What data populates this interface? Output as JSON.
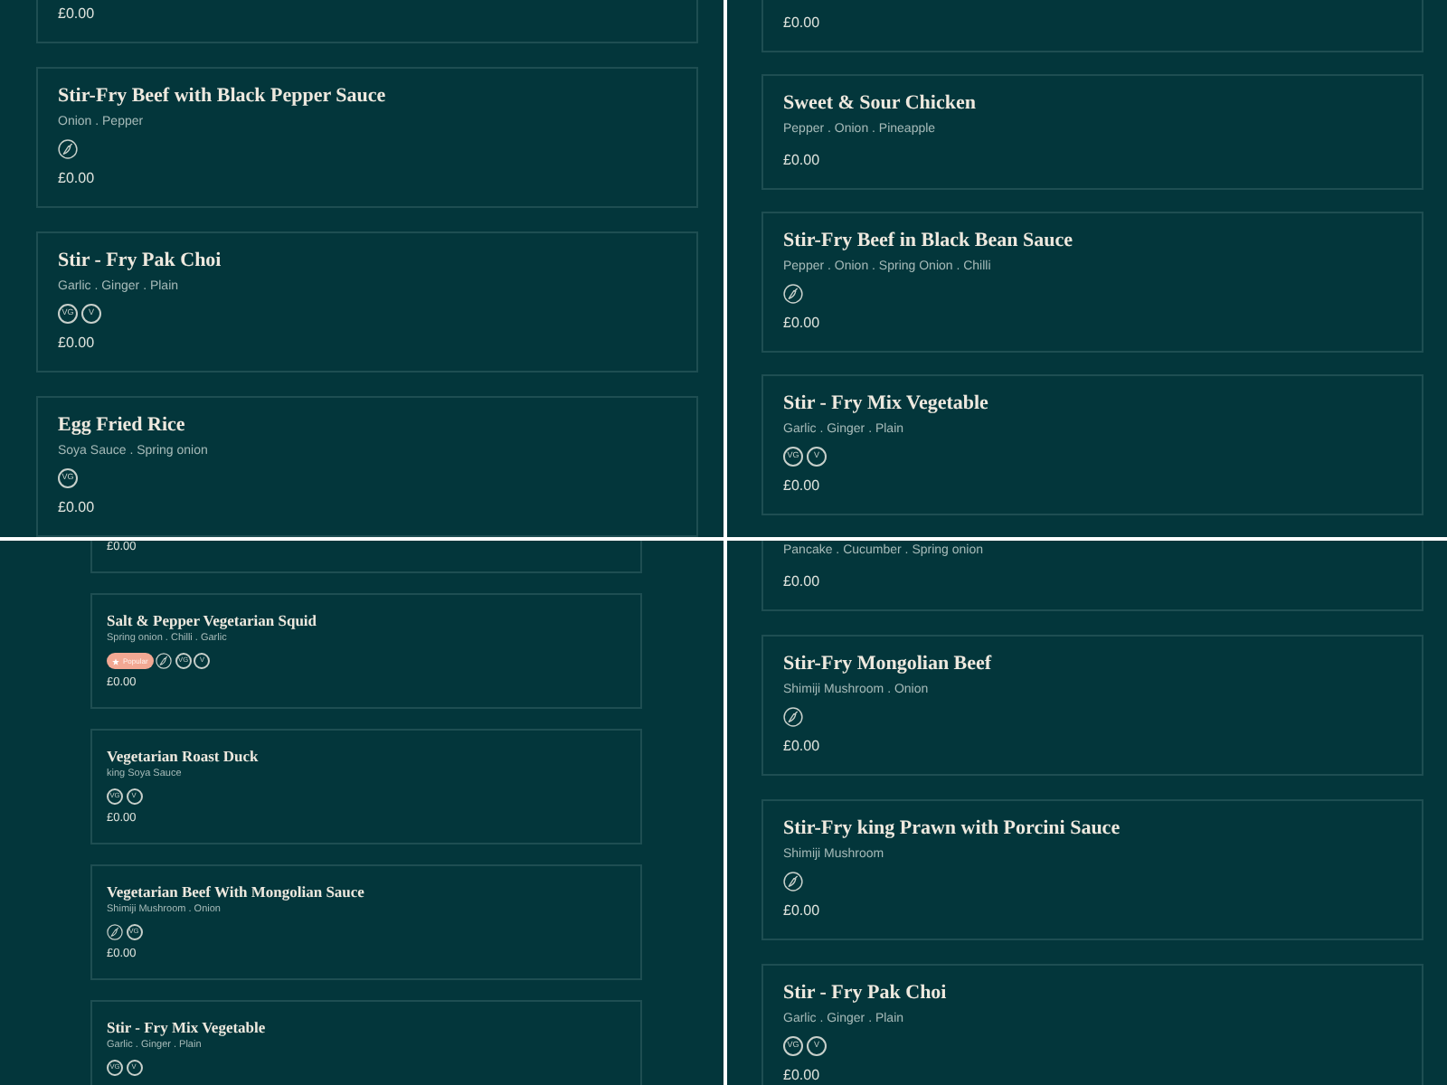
{
  "panels": [
    {
      "items": [
        {
          "price": "£0.00"
        },
        {
          "name": "Stir-Fry Beef with Black Pepper Sauce",
          "description": "Onion . Pepper",
          "marks": [
            {
              "kind": "chilli"
            }
          ],
          "price": "£0.00"
        },
        {
          "name": "Stir - Fry Pak Choi",
          "description": "Garlic . Ginger . Plain",
          "marks": [
            {
              "kind": "vegan",
              "text": "VG"
            },
            {
              "kind": "vegetarian",
              "text": "V"
            }
          ],
          "price": "£0.00"
        },
        {
          "name": "Egg Fried Rice",
          "description": "Soya Sauce . Spring onion",
          "marks": [
            {
              "kind": "vegan",
              "text": "VG"
            }
          ],
          "price": "£0.00"
        }
      ]
    },
    {
      "items": [
        {
          "price": "£0.00"
        },
        {
          "name": "Sweet & Sour Chicken",
          "description": "Pepper . Onion . Pineapple",
          "price": "£0.00"
        },
        {
          "name": "Stir-Fry Beef in Black Bean Sauce",
          "description": "Pepper . Onion . Spring Onion . Chilli",
          "marks": [
            {
              "kind": "chilli"
            }
          ],
          "price": "£0.00"
        },
        {
          "name": "Stir - Fry Mix Vegetable",
          "description": "Garlic . Ginger . Plain",
          "marks": [
            {
              "kind": "vegan",
              "text": "VG"
            },
            {
              "kind": "vegetarian",
              "text": "V"
            }
          ],
          "price": "£0.00"
        }
      ]
    },
    {
      "items": [
        {
          "price": "£0.00"
        },
        {
          "name": "Salt & Pepper Vegetarian Squid",
          "description": "Spring onion . Chilli . Garlic",
          "marks": [
            {
              "kind": "tag",
              "text": "Popular"
            },
            {
              "kind": "chilli"
            },
            {
              "kind": "vegan",
              "text": "VG"
            },
            {
              "kind": "vegetarian",
              "text": "V"
            }
          ],
          "price": "£0.00"
        },
        {
          "name": "Vegetarian Roast Duck",
          "description": "king Soya Sauce",
          "marks": [
            {
              "kind": "vegan",
              "text": "VG"
            },
            {
              "kind": "vegetarian",
              "text": "V"
            }
          ],
          "price": "£0.00"
        },
        {
          "name": "Vegetarian Beef With Mongolian Sauce",
          "description": "Shimiji Mushroom . Onion",
          "marks": [
            {
              "kind": "chilli"
            },
            {
              "kind": "vegan",
              "text": "VG"
            }
          ],
          "price": "£0.00"
        },
        {
          "name": "Stir - Fry Mix Vegetable",
          "description": "Garlic . Ginger . Plain",
          "marks": [
            {
              "kind": "vegan",
              "text": "VG"
            },
            {
              "kind": "vegetarian",
              "text": "V"
            }
          ]
        }
      ]
    },
    {
      "items": [
        {
          "description": "Pancake . Cucumber . Spring onion",
          "price": "£0.00"
        },
        {
          "name": "Stir-Fry Mongolian Beef",
          "description": "Shimiji Mushroom . Onion",
          "marks": [
            {
              "kind": "chilli"
            }
          ],
          "price": "£0.00"
        },
        {
          "name": "Stir-Fry king Prawn with Porcini Sauce",
          "description": "Shimiji Mushroom",
          "marks": [
            {
              "kind": "chilli"
            }
          ],
          "price": "£0.00"
        },
        {
          "name": "Stir - Fry Pak Choi",
          "description": "Garlic . Ginger . Plain",
          "marks": [
            {
              "kind": "vegan",
              "text": "VG"
            },
            {
              "kind": "vegetarian",
              "text": "V"
            }
          ],
          "price": "£0.00"
        }
      ]
    }
  ]
}
